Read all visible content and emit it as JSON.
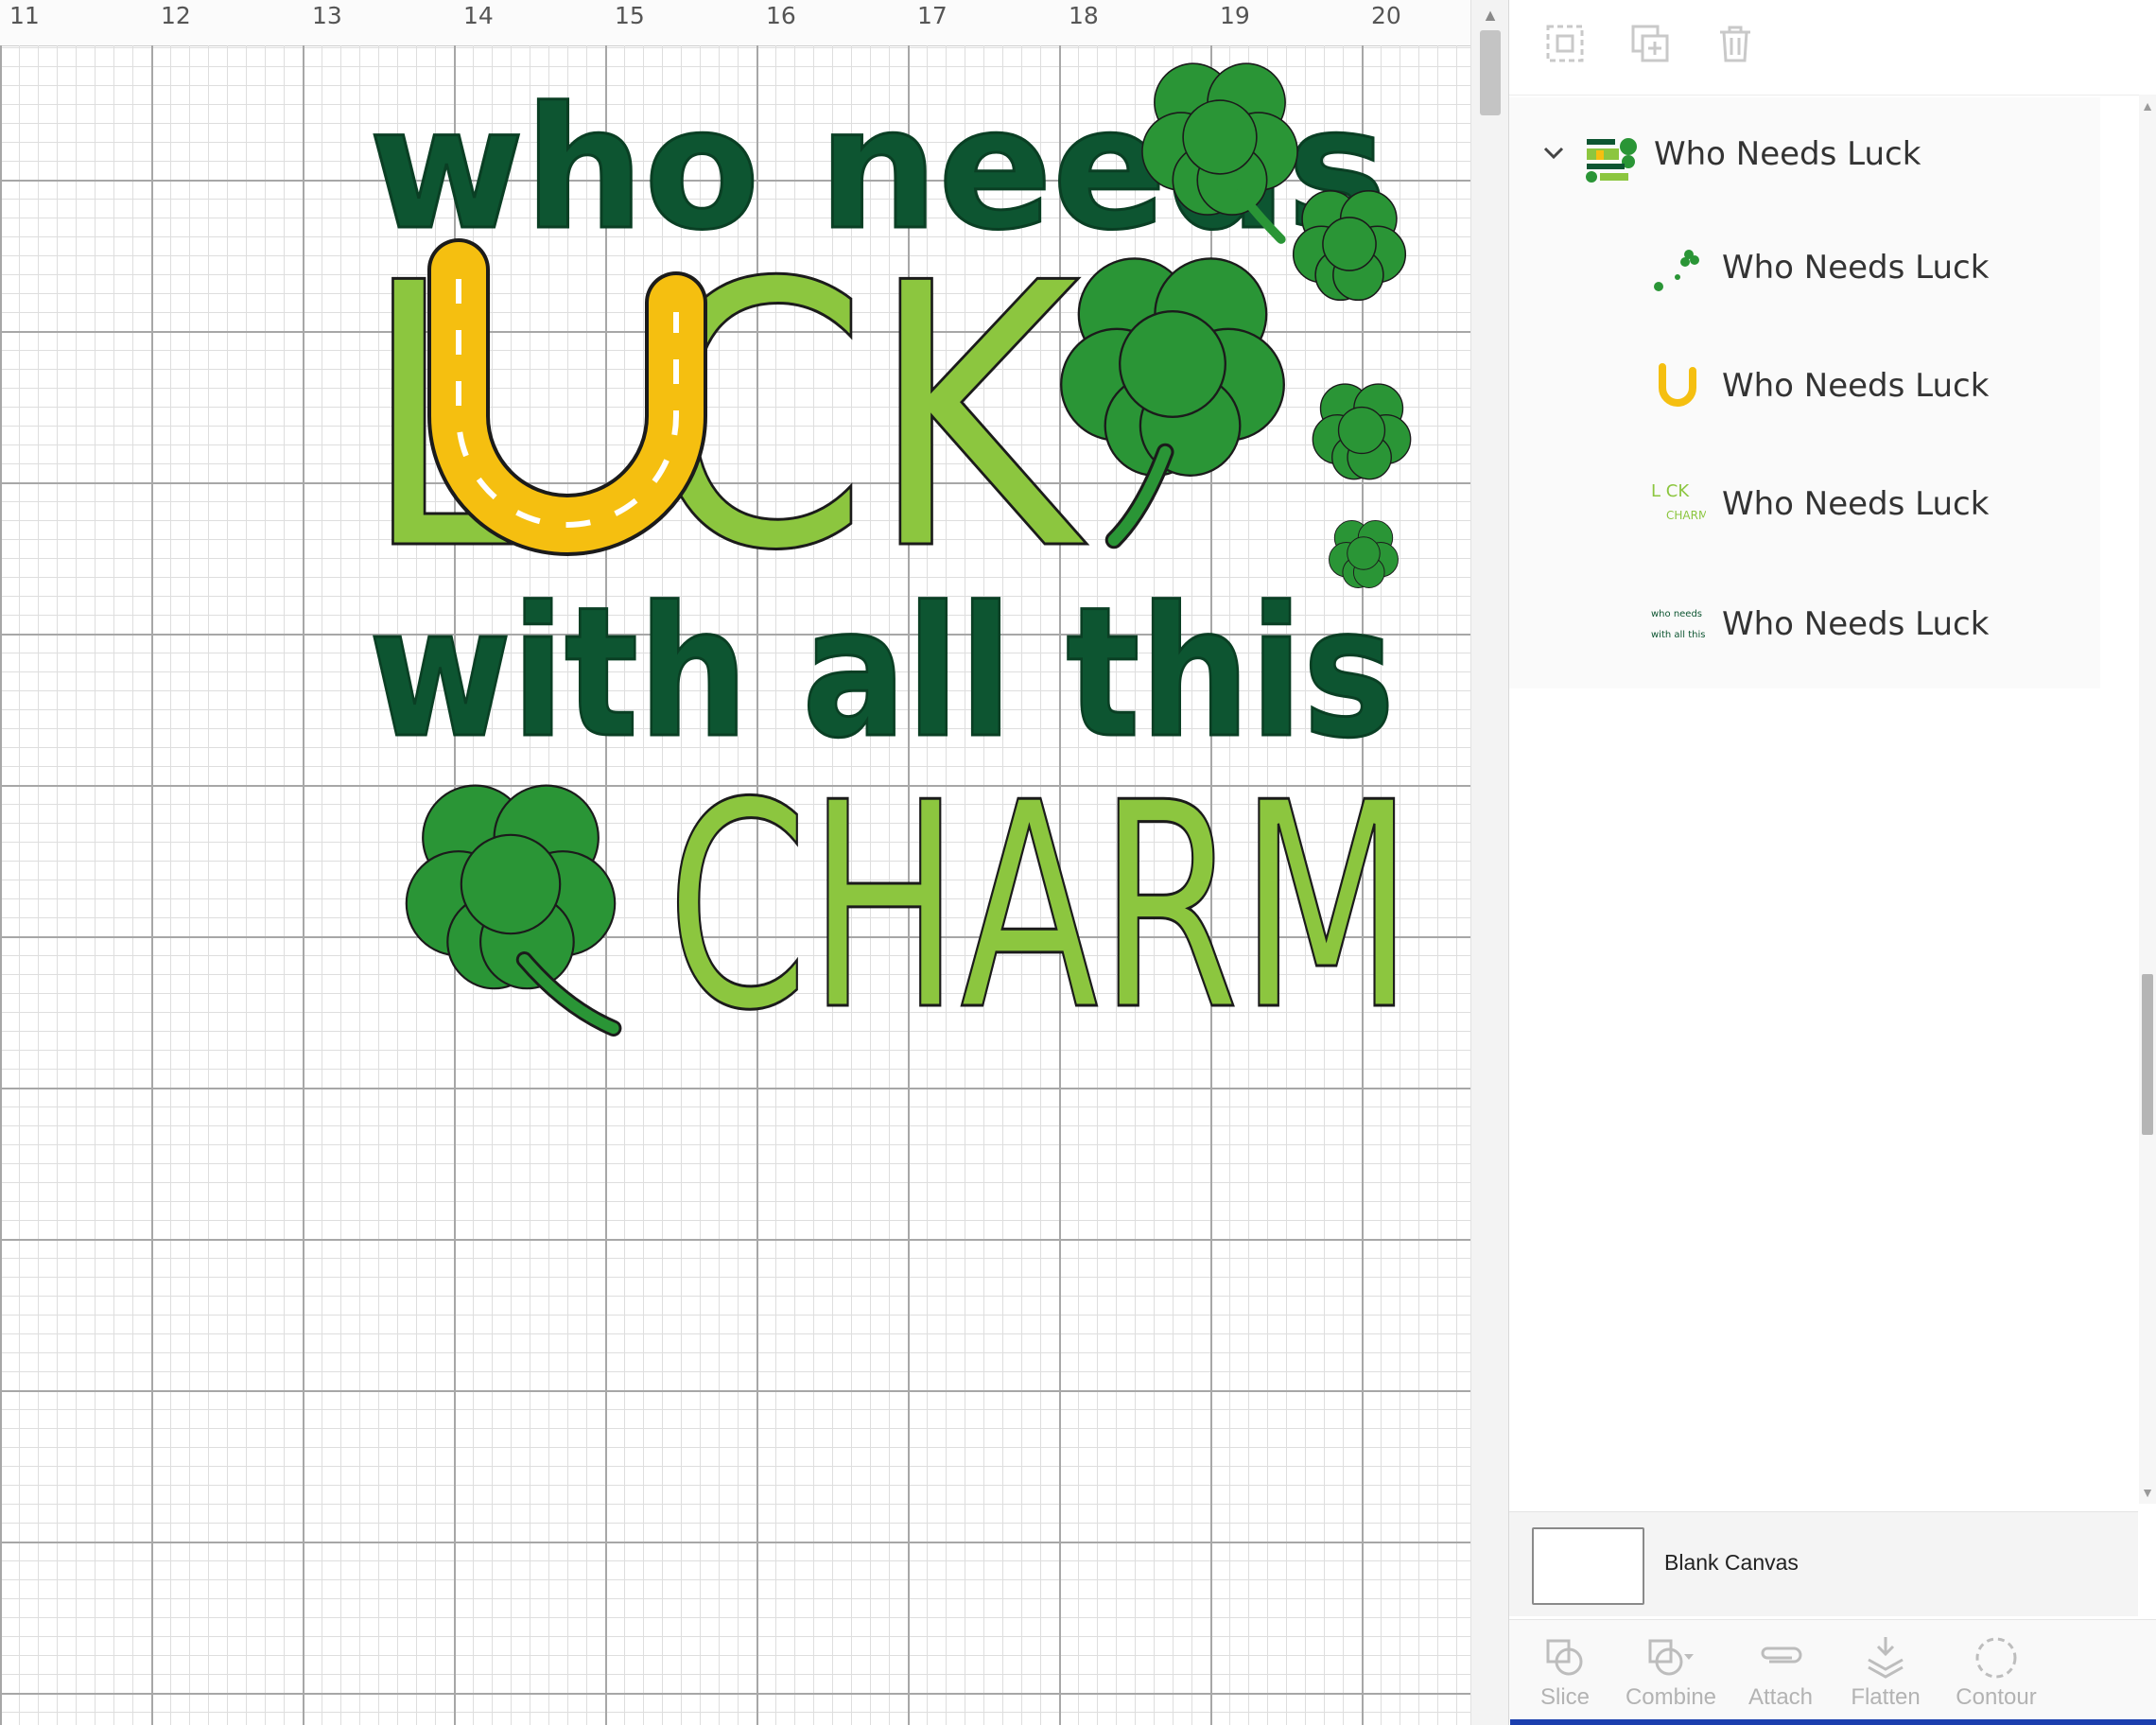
{
  "ruler": {
    "labels": [
      "11",
      "12",
      "13",
      "14",
      "15",
      "16",
      "17",
      "18",
      "19",
      "20"
    ]
  },
  "design": {
    "line1": "who needs",
    "line2_luck": "L CK",
    "line3": "with all this",
    "line4": "CHARM",
    "colors": {
      "dark_green": "#0d5531",
      "light_green": "#8cc63f",
      "shamrock": "#2a9536",
      "horseshoe": "#f5bf10",
      "outline": "#1b1b1b"
    }
  },
  "panel": {
    "toolbar": {
      "icons": [
        "group-icon",
        "duplicate-icon",
        "delete-icon"
      ]
    },
    "layers": [
      {
        "label": "Who Needs Luck",
        "thumb": "full-design-thumb",
        "expanded": true
      },
      {
        "label": "Who Needs Luck",
        "thumb": "shamrock-thumb"
      },
      {
        "label": "Who Needs Luck",
        "thumb": "horseshoe-thumb"
      },
      {
        "label": "Who Needs Luck",
        "thumb": "light-green-text-thumb",
        "thumb_text_1": "L CK",
        "thumb_text_2": "CHARM"
      },
      {
        "label": "Who Needs Luck",
        "thumb": "dark-green-text-thumb",
        "thumb_text_1": "who needs",
        "thumb_text_2": "with all this"
      }
    ],
    "blank_canvas": {
      "label": "Blank Canvas"
    },
    "bottom_tools": [
      {
        "label": "Slice",
        "icon": "slice-icon"
      },
      {
        "label": "Combine",
        "icon": "combine-icon"
      },
      {
        "label": "Attach",
        "icon": "attach-icon"
      },
      {
        "label": "Flatten",
        "icon": "flatten-icon"
      },
      {
        "label": "Contour",
        "icon": "contour-icon"
      }
    ]
  }
}
